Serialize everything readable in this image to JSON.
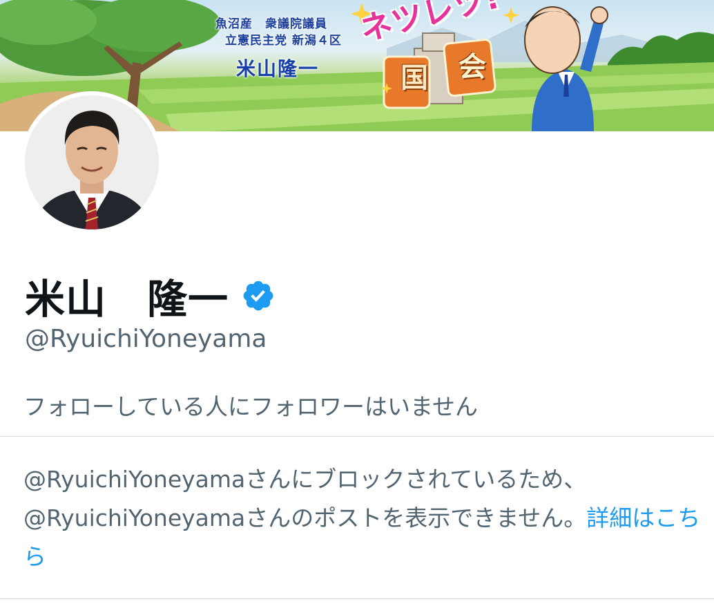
{
  "banner": {
    "line1": "魚沼産　衆議院議員",
    "line2": "立憲民主党 新潟４区",
    "name": "米山隆一",
    "slogan": "ネツレツ!",
    "slogan_char1": "国",
    "slogan_char2": "会"
  },
  "profile": {
    "display_name": "米山　隆一",
    "verified_icon": "verified-badge-icon",
    "handle": "@RyuichiYoneyama",
    "follow_note": "フォローしている人にフォロワーはいません"
  },
  "blocked": {
    "line1": "@RyuichiYoneyamaさんにブロックされているため、",
    "line2": "@RyuichiYoneyamaさんのポストを表示できません。",
    "learn_more": "詳細はこちら"
  },
  "colors": {
    "link": "#1d9bf0",
    "secondary_text": "#536471",
    "primary_text": "#0f1419",
    "verified": "#1d9bf0"
  }
}
